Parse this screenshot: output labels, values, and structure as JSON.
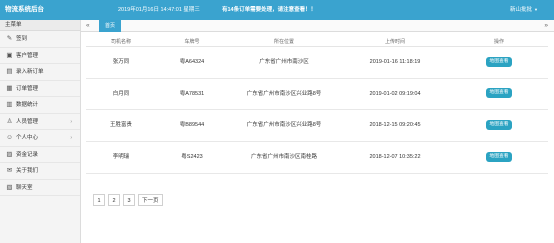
{
  "header": {
    "app_title": "物流系统后台",
    "datetime": "2019年01月16日 14:47:01 星期三",
    "notice": "有14条订单需要处理，请注意查看！！",
    "user": "新山批批",
    "user_caret": "▼"
  },
  "sidebar": {
    "title": "主菜单",
    "items": [
      {
        "label": "签到",
        "icon": "✎",
        "arrow": ""
      },
      {
        "label": "客户管理",
        "icon": "▣",
        "arrow": ""
      },
      {
        "label": "录入新订单",
        "icon": "▤",
        "arrow": ""
      },
      {
        "label": "订单管理",
        "icon": "▦",
        "arrow": ""
      },
      {
        "label": "数据统计",
        "icon": "▥",
        "arrow": ""
      },
      {
        "label": "人员管理",
        "icon": "♙",
        "arrow": "›"
      },
      {
        "label": "个人中心",
        "icon": "☺",
        "arrow": "›"
      },
      {
        "label": "资金记录",
        "icon": "▨",
        "arrow": ""
      },
      {
        "label": "关于我们",
        "icon": "✉",
        "arrow": ""
      },
      {
        "label": "聊天室",
        "icon": "▧",
        "arrow": ""
      }
    ]
  },
  "tabs": {
    "left": "«",
    "home": "首页",
    "right": "»"
  },
  "table": {
    "headers": [
      "司机名称",
      "车牌号",
      "所在位置",
      "上传时间",
      "操作"
    ],
    "rows": [
      {
        "name": "张万同",
        "plate": "粤A64324",
        "location": "广东省广州市南沙区",
        "time": "2019-01-16 11:18:19",
        "action": "地图查看"
      },
      {
        "name": "白月同",
        "plate": "粤A78531",
        "location": "广东省广州市南沙区兴业路8号",
        "time": "2019-01-02 09:19:04",
        "action": "地图查看"
      },
      {
        "name": "王胜富贵",
        "plate": "粤B89544",
        "location": "广东省广州市南沙区兴业路8号",
        "time": "2018-12-15 09:20:45",
        "action": "地图查看"
      },
      {
        "name": "李明瑞",
        "plate": "粤S2423",
        "location": "广东省广州市南沙区南桂路",
        "time": "2018-12-07 10:35:22",
        "action": "地图查看"
      }
    ]
  },
  "pagination": {
    "pages": [
      "1",
      "2",
      "3"
    ],
    "next": "下一页"
  },
  "colors": {
    "header_bg": "#3aa3cf",
    "button_bg": "#2ba3c2"
  }
}
